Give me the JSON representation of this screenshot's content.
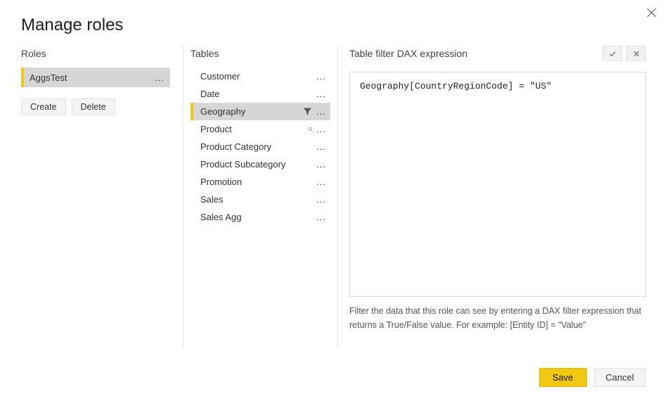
{
  "dialog": {
    "title": "Manage roles"
  },
  "roles": {
    "header": "Roles",
    "items": [
      {
        "name": "AggsTest",
        "selected": true
      }
    ],
    "create_label": "Create",
    "delete_label": "Delete"
  },
  "tables": {
    "header": "Tables",
    "items": [
      {
        "name": "Customer",
        "filtered": false,
        "selected": false,
        "dot": false
      },
      {
        "name": "Date",
        "filtered": false,
        "selected": false,
        "dot": false
      },
      {
        "name": "Geography",
        "filtered": true,
        "selected": true,
        "dot": false
      },
      {
        "name": "Product",
        "filtered": false,
        "selected": false,
        "dot": true
      },
      {
        "name": "Product Category",
        "filtered": false,
        "selected": false,
        "dot": false
      },
      {
        "name": "Product Subcategory",
        "filtered": false,
        "selected": false,
        "dot": false
      },
      {
        "name": "Promotion",
        "filtered": false,
        "selected": false,
        "dot": false
      },
      {
        "name": "Sales",
        "filtered": false,
        "selected": false,
        "dot": false
      },
      {
        "name": "Sales Agg",
        "filtered": false,
        "selected": false,
        "dot": false
      }
    ]
  },
  "expression": {
    "header": "Table filter DAX expression",
    "value": "Geography[CountryRegionCode] = \"US\"",
    "help": "Filter the data that this role can see by entering a DAX filter expression that returns a True/False value. For example: [Entity ID] = \"Value\""
  },
  "footer": {
    "save_label": "Save",
    "cancel_label": "Cancel"
  }
}
